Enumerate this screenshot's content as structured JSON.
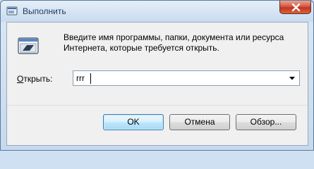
{
  "window": {
    "title": "Выполнить"
  },
  "dialog": {
    "description_line1": "Введите имя программы, папки, документа или ресурса",
    "description_line2": "Интернета, которые требуется открыть.",
    "open_label_accel": "О",
    "open_label_rest": "ткрыть:",
    "open_value": "rrr"
  },
  "buttons": {
    "ok": "OK",
    "cancel": "Отмена",
    "browse": "Обзор..."
  },
  "icons": {
    "app": "run-window-icon",
    "close": "close-icon",
    "run": "run-dialog-icon",
    "dropdown": "chevron-down-icon"
  },
  "colors": {
    "close_button": "#c13521",
    "title_text": "#1e395b",
    "default_button_border": "#3c7fb1"
  }
}
